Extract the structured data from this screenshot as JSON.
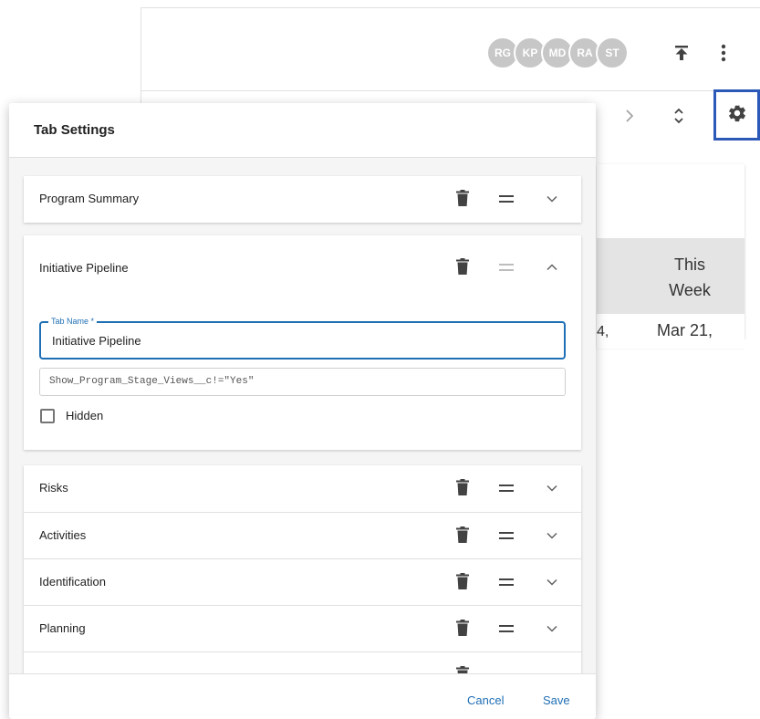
{
  "header": {
    "avatars": [
      "RG",
      "KP",
      "MD",
      "RA",
      "ST"
    ]
  },
  "background_table": {
    "column_header": "This Week",
    "partial_cell": "4,",
    "cell_value": "Mar 21,"
  },
  "modal": {
    "title": "Tab Settings",
    "cancel_label": "Cancel",
    "save_label": "Save",
    "tabs": [
      {
        "label": "Program Summary",
        "expanded": false
      },
      {
        "label": "Initiative Pipeline",
        "expanded": true
      },
      {
        "label": "Risks",
        "expanded": false
      },
      {
        "label": "Activities",
        "expanded": false
      },
      {
        "label": "Identification",
        "expanded": false
      },
      {
        "label": "Planning",
        "expanded": false
      }
    ],
    "expanded_tab": {
      "field_label": "Tab Name *",
      "field_value": "Initiative Pipeline",
      "formula": "Show_Program_Stage_Views__c!=\"Yes\"",
      "hidden_label": "Hidden",
      "hidden_checked": false
    }
  },
  "colors": {
    "accent": "#1f6fb5",
    "highlight_border": "#2c59b8",
    "avatar": "#c7c7c7"
  }
}
